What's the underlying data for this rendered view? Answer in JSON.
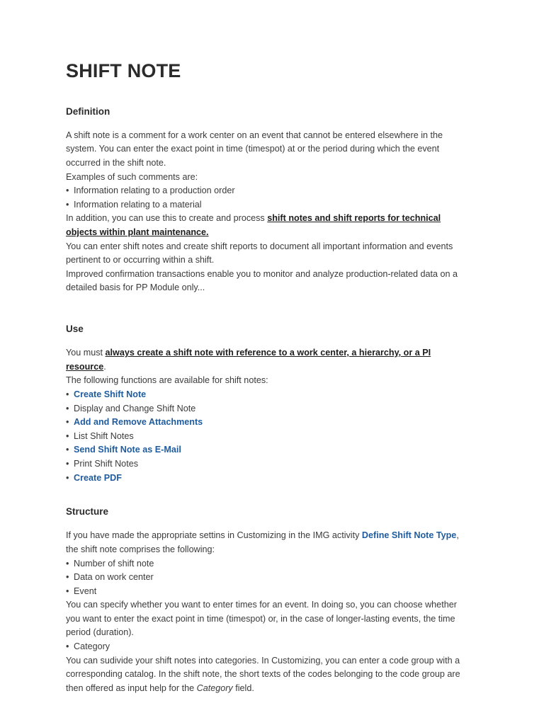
{
  "document": {
    "title": "SHIFT NOTE",
    "sections": [
      {
        "heading": "Definition",
        "paragraph_1": "A shift note is a comment for a work center on an event that cannot be entered elsewhere in the system. You can enter the exact point in time (timespot) at or the period during which the event occurred in the shift note.",
        "paragraph_2": "Examples of such comments are:",
        "bullets": [
          "Information relating to a production order",
          "Information relating to a material"
        ],
        "paragraph_3_prefix": "In addition, you can use this  to create and process ",
        "paragraph_3_emphasis": "shift notes and shift reports for technical objects within plant maintenance.",
        "paragraph_4": "You can enter shift notes and create shift reports to document all important information and events pertinent to or occurring within a shift.",
        "paragraph_5": "Improved confirmation transactions enable you to monitor and analyze production-related data on a detailed basis for PP Module only..."
      },
      {
        "heading": "Use",
        "paragraph_1_prefix": "You must ",
        "paragraph_1_emphasis": "always create a shift note with reference to a work center, a hierarchy, or a PI resource",
        "paragraph_1_suffix": ".",
        "paragraph_2": "The following functions are available for shift notes:",
        "function_list": [
          {
            "label": "Create Shift Note",
            "is_link": true
          },
          {
            "label": "Display and Change Shift Note",
            "is_link": false
          },
          {
            "label": "Add and Remove Attachments",
            "is_link": true
          },
          {
            "label": "List Shift Notes",
            "is_link": false
          },
          {
            "label": "Send Shift Note as E-Mail",
            "is_link": true
          },
          {
            "label": "Print Shift Notes",
            "is_link": false
          },
          {
            "label": "Create PDF",
            "is_link": true
          }
        ]
      },
      {
        "heading": "Structure",
        "paragraph_1_prefix": "If you have made the appropriate settins in Customizing in the IMG activity ",
        "paragraph_1_link": "Define Shift Note Type",
        "paragraph_1_suffix": ", the shift note comprises the following:",
        "bullets": [
          "Number of shift note",
          "Data on work center",
          "Event"
        ],
        "paragraph_2": "You can specify whether you want to enter times for an event. In doing so, you can choose whether you want to enter the exact point in time (timespot) or, in the case of longer-lasting events, the time period (duration).",
        "bullet_category": "Category",
        "paragraph_3_part1": "You can sudivide your shift notes into categories. In Customizing, you can enter a code group with a corresponding catalog. In the shift note, the short texts of the codes belonging to the code group are then offered as input help for the ",
        "paragraph_3_italic": "Category",
        "paragraph_3_part2": " field."
      }
    ],
    "colors": {
      "link": "#1f5c9e",
      "body_text": "#3a3a3a",
      "heading_text": "#2b2b2b",
      "page_background": "#ffffff"
    },
    "bullet_glyph": "•"
  }
}
